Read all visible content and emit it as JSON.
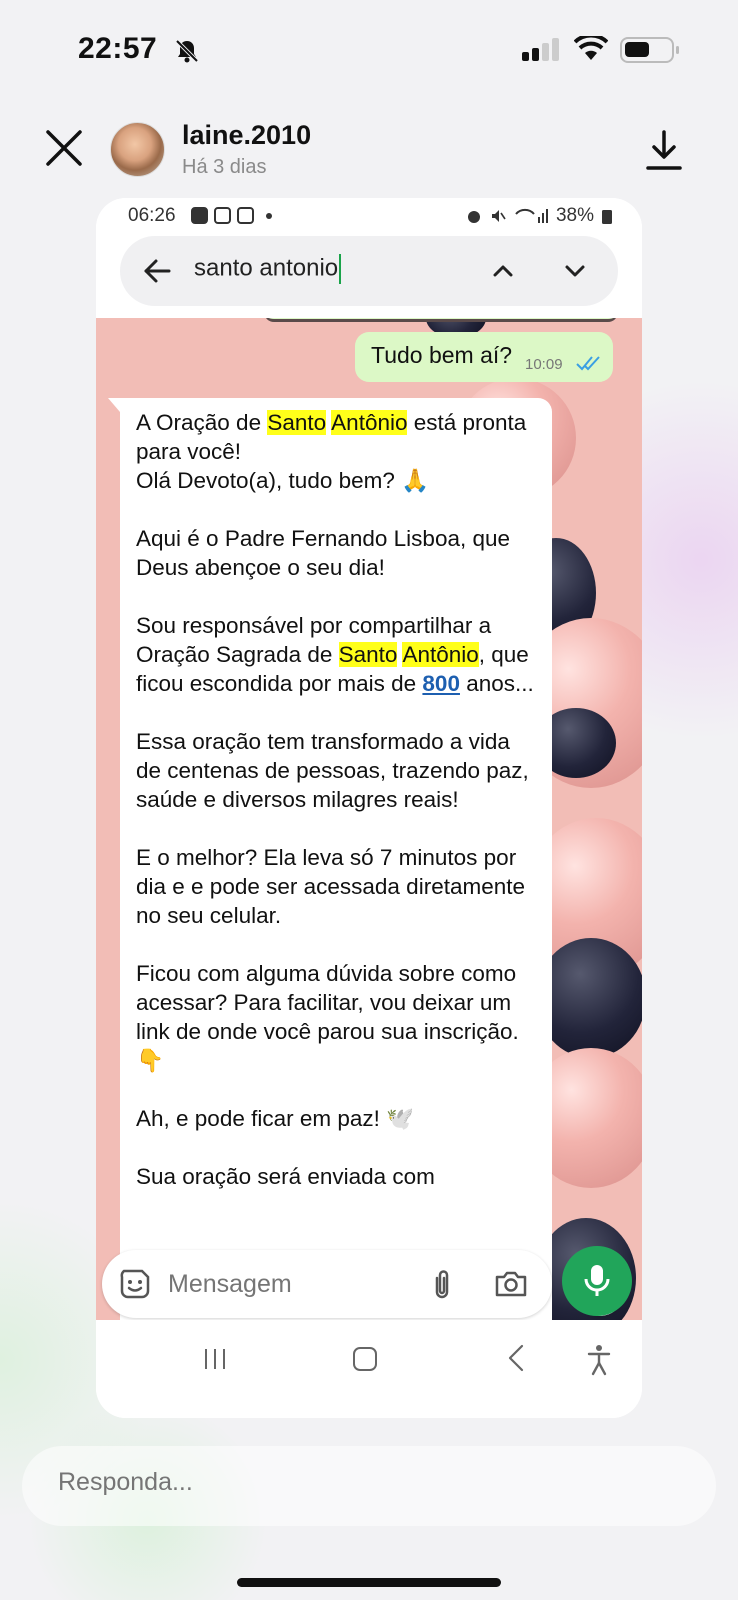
{
  "ios_status": {
    "time": "22:57",
    "icons": [
      "bell-slash-icon",
      "cellular-signal-icon",
      "wifi-icon",
      "battery-icon"
    ]
  },
  "story": {
    "username": "laine.2010",
    "time_ago": "Há 3 dias"
  },
  "android_status": {
    "time": "06:26",
    "battery": "38%"
  },
  "search": {
    "query": "santo antonio"
  },
  "chat": {
    "outgoing": {
      "text": "Tudo bem aí?",
      "time": "10:09"
    },
    "incoming": {
      "line1_a": "A Oração de ",
      "hl_santo": "Santo",
      "hl_antonio": "Antônio",
      "line1_b": " está pronta para você!",
      "greeting": "Olá Devoto(a), tudo bem? 🙏",
      "p2": "Aqui é o Padre Fernando Lisboa, que Deus abençoe o seu dia!",
      "p3_a": "Sou responsável por compartilhar a Oração Sagrada de ",
      "p3_b": ", que ficou escondida por mais de ",
      "p3_num": "800",
      "p3_c": " anos...",
      "p4": "Essa oração tem transformado a vida de centenas de pessoas, trazendo paz, saúde e diversos milagres reais!",
      "p5": "E o melhor? Ela leva só 7 minutos por dia e e pode ser acessada diretamente no seu celular.",
      "p6": "Ficou com alguma dúvida sobre como acessar? Para facilitar, vou deixar um link de onde você parou sua inscrição. 👇",
      "p7": "Ah, e pode ficar em paz! 🕊️",
      "p8": "Sua oração será enviada com"
    }
  },
  "composer": {
    "placeholder": "Mensagem"
  },
  "reply": {
    "placeholder": "Responda..."
  },
  "colors": {
    "highlight": "#ffff1a",
    "outgoing_bubble": "#dcf8c6",
    "mic": "#21a55a",
    "link": "#1d5fb0"
  }
}
